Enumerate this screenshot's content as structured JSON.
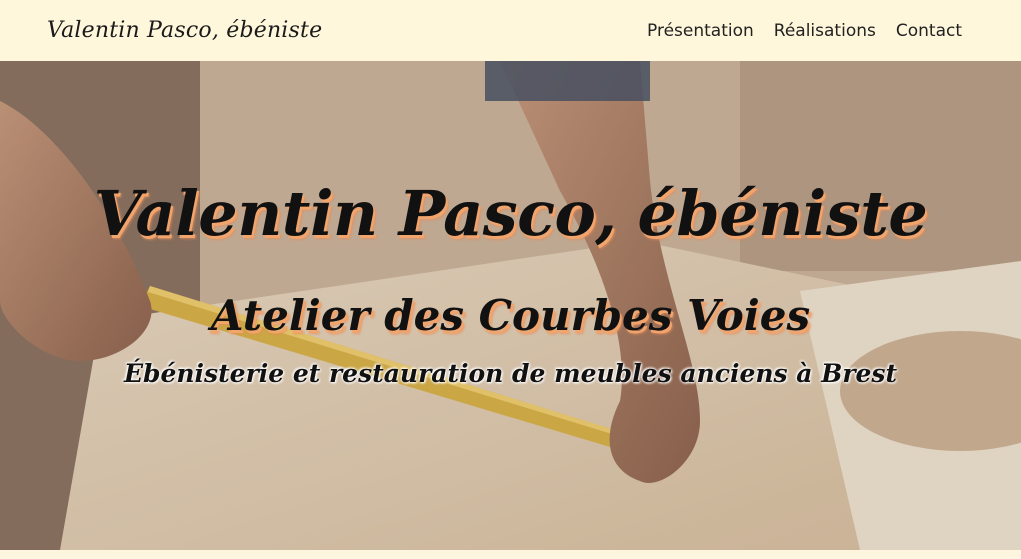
{
  "navbar": {
    "brand": "Valentin Pasco, ébéniste",
    "links": [
      {
        "label": "Présentation"
      },
      {
        "label": "Réalisations"
      },
      {
        "label": "Contact"
      }
    ]
  },
  "hero": {
    "title": "Valentin Pasco, ébéniste",
    "subtitle": "Atelier des Courbes Voies",
    "tagline": "Ébénisterie et restauration de meubles anciens à Brest"
  },
  "colors": {
    "navbar_bg": "#fff7dc",
    "title_shadow": "#f1a46c",
    "text": "#111111"
  }
}
